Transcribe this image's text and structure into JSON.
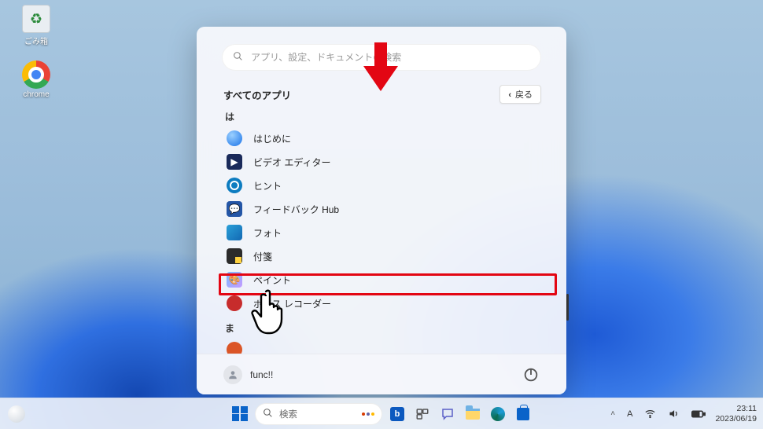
{
  "desktop": {
    "icons": [
      {
        "name": "recycle-bin",
        "label": "ごみ箱"
      },
      {
        "name": "chrome",
        "label": "chrome"
      }
    ]
  },
  "start_menu": {
    "search_placeholder": "アプリ、設定、ドキュメントの検索",
    "all_apps_title": "すべてのアプリ",
    "back_label": "戻る",
    "sections": [
      {
        "letter": "は",
        "items": [
          {
            "id": "hajimeni",
            "label": "はじめに",
            "icon": "globe"
          },
          {
            "id": "video-editor",
            "label": "ビデオ エディター",
            "icon": "video"
          },
          {
            "id": "hint",
            "label": "ヒント",
            "icon": "hint"
          },
          {
            "id": "feedback-hub",
            "label": "フィードバック Hub",
            "icon": "feedback"
          },
          {
            "id": "photos",
            "label": "フォト",
            "icon": "photo"
          },
          {
            "id": "sticky-notes",
            "label": "付箋",
            "icon": "sticky"
          },
          {
            "id": "paint",
            "label": "ペイント",
            "icon": "paint"
          },
          {
            "id": "voice-recorder",
            "label": "ボイス レコーダー",
            "icon": "rec"
          }
        ]
      },
      {
        "letter": "ま",
        "items": []
      }
    ],
    "user": {
      "name": "func!!"
    }
  },
  "taskbar": {
    "search_label": "検索",
    "ime": "A",
    "time": "23:11",
    "date": "2023/06/19"
  },
  "annotations": {
    "highlighted_app": "paint"
  }
}
